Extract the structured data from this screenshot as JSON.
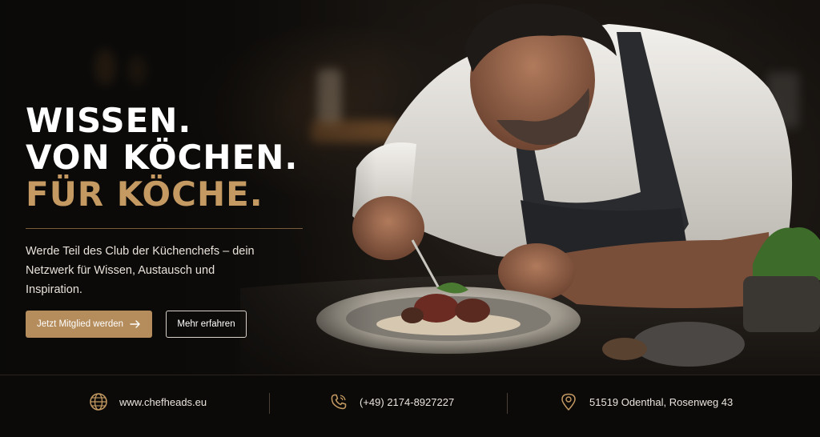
{
  "hero": {
    "headline": [
      "WISSEN.",
      "VON KÖCHEN.",
      "FÜR KÖCHE."
    ],
    "intro": "Werde Teil des Club der Küchenchefs – dein Netzwerk für Wissen, Austausch und Inspiration.",
    "primary_button": "Jetzt Mitglied werden",
    "secondary_button": "Mehr erfahren"
  },
  "contact": {
    "website": "www.chefheads.eu",
    "phone": "(+49) 2174-8927227",
    "address": "51519 Odenthal, Rosenweg 43"
  },
  "colors": {
    "accent_gold": "#c49a62",
    "button_gold": "#b58c5b",
    "background": "#0d0b09"
  },
  "icons": [
    "globe-icon",
    "phone-icon",
    "location-pin-icon",
    "arrow-right-icon"
  ]
}
